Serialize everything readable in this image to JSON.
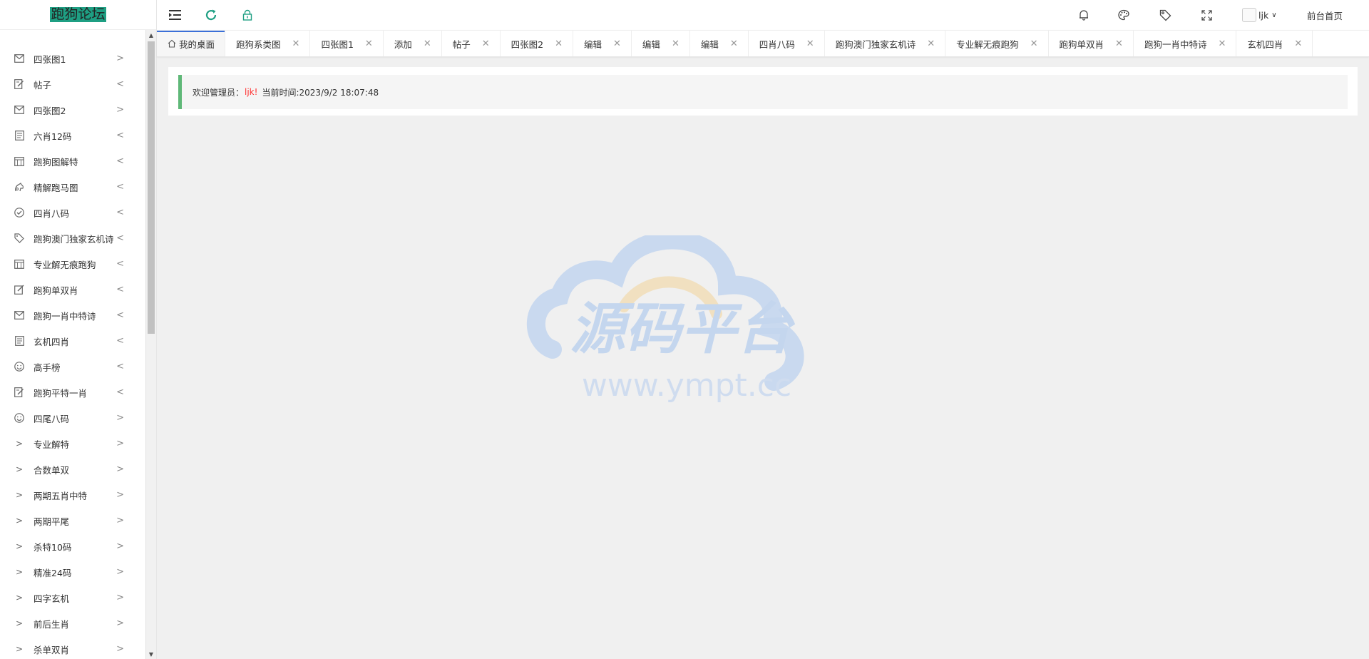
{
  "app": {
    "logo_text": "跑狗论坛"
  },
  "sidebar": {
    "items": [
      {
        "label": "四张图1",
        "icon": "mail-icon",
        "arrow": ">"
      },
      {
        "label": "帖子",
        "icon": "edit-doc-icon",
        "arrow": "<"
      },
      {
        "label": "四张图2",
        "icon": "mail-icon",
        "arrow": ">"
      },
      {
        "label": "六肖12码",
        "icon": "notebook-icon",
        "arrow": "<"
      },
      {
        "label": "跑狗图解特",
        "icon": "calendar-icon",
        "arrow": "<"
      },
      {
        "label": "精解跑马图",
        "icon": "horse-icon",
        "arrow": "<"
      },
      {
        "label": "四肖八码",
        "icon": "check-circle-icon",
        "arrow": "<"
      },
      {
        "label": "跑狗澳门独家玄机诗",
        "icon": "tag-icon",
        "arrow": "<"
      },
      {
        "label": "专业解无痕跑狗",
        "icon": "calendar-icon",
        "arrow": "<"
      },
      {
        "label": "跑狗单双肖",
        "icon": "edit-icon",
        "arrow": "<"
      },
      {
        "label": "跑狗一肖中特诗",
        "icon": "mail-icon",
        "arrow": "<"
      },
      {
        "label": "玄机四肖",
        "icon": "notebook-icon",
        "arrow": "<"
      },
      {
        "label": "高手榜",
        "icon": "smile-icon",
        "arrow": "<"
      },
      {
        "label": "跑狗平特一肖",
        "icon": "edit-doc-icon",
        "arrow": "<"
      },
      {
        "label": "四尾八码",
        "icon": "smile-icon",
        "arrow": ">"
      },
      {
        "label": "专业解特",
        "icon": "chevron-right-icon",
        "arrow": ">"
      },
      {
        "label": "合数单双",
        "icon": "chevron-right-icon",
        "arrow": ">"
      },
      {
        "label": "两期五肖中特",
        "icon": "chevron-right-icon",
        "arrow": ">"
      },
      {
        "label": "两期平尾",
        "icon": "chevron-right-icon",
        "arrow": ">"
      },
      {
        "label": "杀特10码",
        "icon": "chevron-right-icon",
        "arrow": ">"
      },
      {
        "label": "精准24码",
        "icon": "chevron-right-icon",
        "arrow": ">"
      },
      {
        "label": "四字玄机",
        "icon": "chevron-right-icon",
        "arrow": ">"
      },
      {
        "label": "前后生肖",
        "icon": "chevron-right-icon",
        "arrow": ">"
      },
      {
        "label": "杀单双肖",
        "icon": "chevron-right-icon",
        "arrow": ">"
      }
    ]
  },
  "header": {
    "user_name": "ljk",
    "front_link": "前台首页"
  },
  "tabs": [
    {
      "label": "我的桌面",
      "active": true,
      "closable": false
    },
    {
      "label": "跑狗系类图",
      "closable": true
    },
    {
      "label": "四张图1",
      "closable": true
    },
    {
      "label": "添加",
      "closable": true
    },
    {
      "label": "帖子",
      "closable": true
    },
    {
      "label": "四张图2",
      "closable": true
    },
    {
      "label": "编辑",
      "closable": true
    },
    {
      "label": "编辑",
      "closable": true
    },
    {
      "label": "编辑",
      "closable": true
    },
    {
      "label": "四肖八码",
      "closable": true
    },
    {
      "label": "跑狗澳门独家玄机诗",
      "closable": true
    },
    {
      "label": "专业解无痕跑狗",
      "closable": true
    },
    {
      "label": "跑狗单双肖",
      "closable": true
    },
    {
      "label": "跑狗一肖中特诗",
      "closable": true
    },
    {
      "label": "玄机四肖",
      "closable": true
    }
  ],
  "welcome": {
    "prefix": "欢迎管理员：",
    "user": "ljk!",
    "time_label": "当前时间:2023/9/2 18:07:48"
  },
  "watermark": {
    "title": "源码平台",
    "url": "www.ympt.cc"
  },
  "colors": {
    "accent_green": "#1e9f83",
    "welcome_border": "#5fb878",
    "active_tab_line": "#3a6fd8",
    "username_red": "#ff3333"
  }
}
